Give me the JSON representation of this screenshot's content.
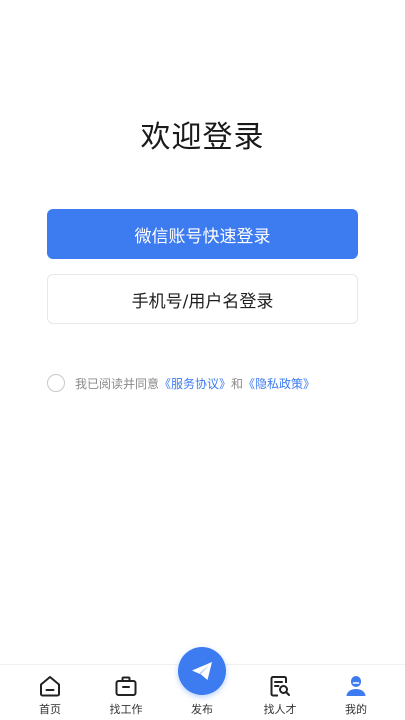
{
  "login": {
    "title": "欢迎登录",
    "wechat_button": "微信账号快速登录",
    "phone_button": "手机号/用户名登录"
  },
  "agreement": {
    "prefix": "我已阅读并同意",
    "service_link": "《服务协议》",
    "conjunction": "和",
    "privacy_link": "《隐私政策》"
  },
  "tabbar": {
    "items": [
      {
        "label": "首页",
        "icon": "home-icon"
      },
      {
        "label": "找工作",
        "icon": "briefcase-icon"
      },
      {
        "label": "发布",
        "icon": "paper-plane-icon"
      },
      {
        "label": "找人才",
        "icon": "document-search-icon"
      },
      {
        "label": "我的",
        "icon": "user-icon"
      }
    ],
    "active_index": 4
  },
  "colors": {
    "accent": "#3d7bf1",
    "text_dark": "#1a1a1a",
    "text_muted": "#8a8a8a",
    "border": "#e6e8eb"
  }
}
